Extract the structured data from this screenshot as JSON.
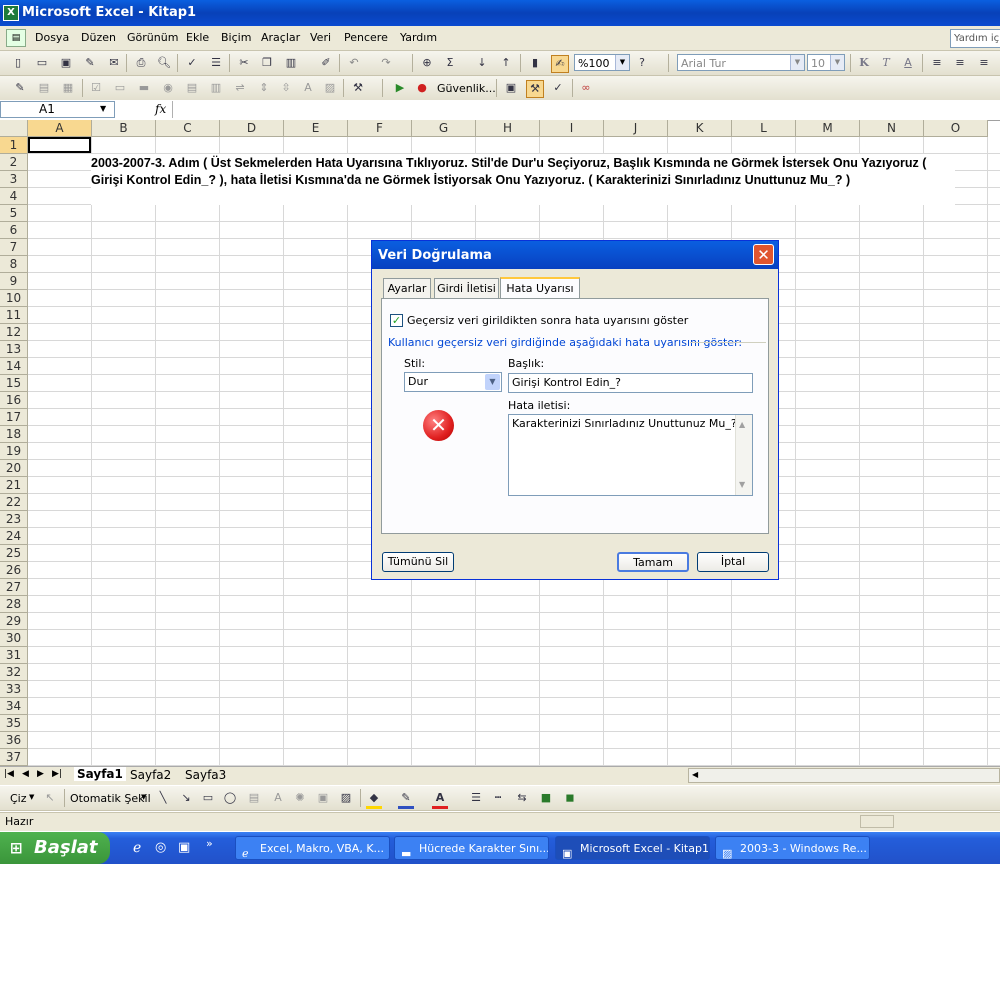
{
  "window": {
    "title": "Microsoft Excel - Kitap1"
  },
  "menu": {
    "items": [
      "Dosya",
      "Düzen",
      "Görünüm",
      "Ekle",
      "Biçim",
      "Araçlar",
      "Veri",
      "Pencere",
      "Yardım"
    ],
    "help_placeholder": "Yardım için"
  },
  "toolbar": {
    "zoom": "%100",
    "font": "Arial Tur",
    "font_size": "10",
    "security_label": "Güvenlik...",
    "bold": "K",
    "italic": "T",
    "underline": "A"
  },
  "formula_bar": {
    "name_box": "A1",
    "fx": "fx"
  },
  "grid": {
    "columns": [
      "A",
      "B",
      "C",
      "D",
      "E",
      "F",
      "G",
      "H",
      "I",
      "J",
      "K",
      "L",
      "M",
      "N",
      "O"
    ],
    "rows": [
      "1",
      "2",
      "3",
      "4",
      "5",
      "6",
      "7",
      "8",
      "9",
      "10",
      "11",
      "12",
      "13",
      "14",
      "15",
      "16",
      "17",
      "18",
      "19",
      "20",
      "21",
      "22",
      "23",
      "24",
      "25",
      "26",
      "27",
      "28",
      "29",
      "30",
      "31",
      "32",
      "33",
      "34",
      "35",
      "36",
      "37"
    ],
    "cell_text": "2003-2007-3. Adım ( Üst Sekmelerden Hata Uyarısına Tıklıyoruz. Stil'de Dur'u Seçiyoruz, Başlık Kısmında ne Görmek İstersek Onu Yazıyoruz ( Girişi Kontrol Edin_? ), hata İletisi Kısmına'da ne Görmek İstiyorsak Onu Yazıyoruz. ( Karakterinizi Sınırladınız Unuttunuz Mu_? )"
  },
  "sheet_tabs": [
    "Sayfa1",
    "Sayfa2",
    "Sayfa3"
  ],
  "draw_toolbar": {
    "draw": "Çiz",
    "autoshapes": "Otomatik Şekil"
  },
  "status": {
    "text": "Hazır"
  },
  "taskbar": {
    "start": "Başlat",
    "buttons": [
      "Excel, Makro, VBA, K...",
      "Hücrede Karakter Sını...",
      "Microsoft Excel - Kitap1",
      "2003-3 - Windows Re..."
    ]
  },
  "dialog": {
    "title": "Veri Doğrulama",
    "tabs": [
      "Ayarlar",
      "Girdi İletisi",
      "Hata Uyarısı"
    ],
    "checkbox_label": "Geçersiz veri girildikten sonra hata uyarısını göster",
    "checkbox_checked": true,
    "group_label": "Kullanıcı geçersiz veri girdiğinde aşağıdaki hata uyarısını göster:",
    "style_label": "Stil:",
    "style_value": "Dur",
    "title_label": "Başlık:",
    "title_value": "Girişi Kontrol Edin_?",
    "message_label": "Hata iletisi:",
    "message_value": "Karakterinizi Sınırladınız Unuttunuz Mu_?",
    "clear_all": "Tümünü Sil",
    "ok": "Tamam",
    "cancel": "İptal"
  },
  "colors": {
    "title_blue": "#0a5fe0",
    "taskbar_blue": "#245edb",
    "start_green": "#3a953a",
    "error_red": "#e02020",
    "selected_header": "#f8d890"
  }
}
